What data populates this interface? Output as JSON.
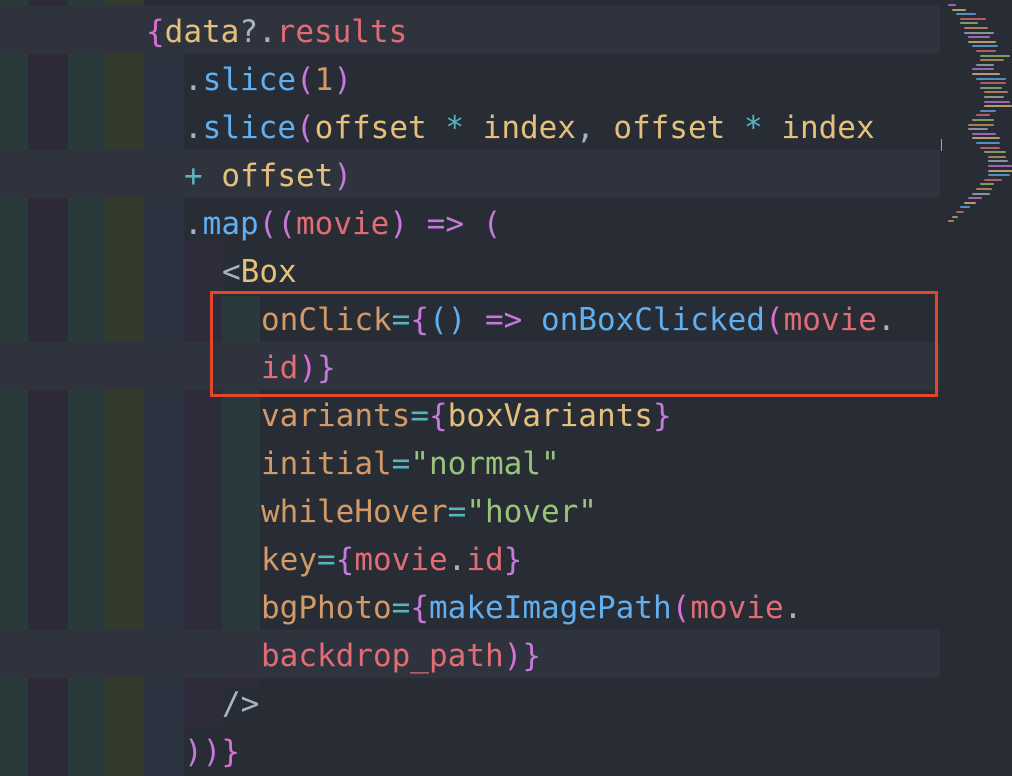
{
  "editor": {
    "colors": {
      "background": "#282c34",
      "highlight_box": "#e2462b",
      "identifier": "#e5c07b",
      "property": "#e06c75",
      "method": "#61afef",
      "string": "#98c379",
      "keyword": "#c678dd",
      "operator": "#56b6c2"
    },
    "lines": [
      [
        {
          "t": "{",
          "c": "c-brace1"
        },
        {
          "t": "data",
          "c": "c-id"
        },
        {
          "t": "?.",
          "c": "c-punct"
        },
        {
          "t": "results",
          "c": "c-prop"
        }
      ],
      [
        {
          "t": ".",
          "c": "c-punct"
        },
        {
          "t": "slice",
          "c": "c-method"
        },
        {
          "t": "(",
          "c": "c-brace2"
        },
        {
          "t": "1",
          "c": "c-num"
        },
        {
          "t": ")",
          "c": "c-brace2"
        }
      ],
      [
        {
          "t": ".",
          "c": "c-punct"
        },
        {
          "t": "slice",
          "c": "c-method"
        },
        {
          "t": "(",
          "c": "c-brace2"
        },
        {
          "t": "offset",
          "c": "c-id"
        },
        {
          "t": " * ",
          "c": "c-op"
        },
        {
          "t": "index",
          "c": "c-id"
        },
        {
          "t": ", ",
          "c": "c-punct"
        },
        {
          "t": "offset",
          "c": "c-id"
        },
        {
          "t": " * ",
          "c": "c-op"
        },
        {
          "t": "index",
          "c": "c-id"
        }
      ],
      [
        {
          "t": "+ ",
          "c": "c-op"
        },
        {
          "t": "offset",
          "c": "c-id"
        },
        {
          "t": ")",
          "c": "c-brace2"
        }
      ],
      [
        {
          "t": ".",
          "c": "c-punct"
        },
        {
          "t": "map",
          "c": "c-method"
        },
        {
          "t": "((",
          "c": "c-brace2"
        },
        {
          "t": "movie",
          "c": "c-var"
        },
        {
          "t": ") ",
          "c": "c-brace2"
        },
        {
          "t": "=>",
          "c": "c-kw"
        },
        {
          "t": " (",
          "c": "c-brace2"
        }
      ],
      [
        {
          "t": "<",
          "c": "c-punct"
        },
        {
          "t": "Box",
          "c": "c-tag"
        }
      ],
      [
        {
          "t": "onClick",
          "c": "c-attr"
        },
        {
          "t": "=",
          "c": "c-op"
        },
        {
          "t": "{",
          "c": "c-brace2"
        },
        {
          "t": "()",
          "c": "c-brace3"
        },
        {
          "t": " => ",
          "c": "c-kw"
        },
        {
          "t": "onBoxClicked",
          "c": "c-fn"
        },
        {
          "t": "(",
          "c": "c-brace1"
        },
        {
          "t": "movie",
          "c": "c-var"
        },
        {
          "t": ".",
          "c": "c-punct"
        }
      ],
      [
        {
          "t": "id",
          "c": "c-var"
        },
        {
          "t": ")",
          "c": "c-brace1"
        },
        {
          "t": "}",
          "c": "c-brace2"
        }
      ],
      [
        {
          "t": "variants",
          "c": "c-attr"
        },
        {
          "t": "=",
          "c": "c-op"
        },
        {
          "t": "{",
          "c": "c-brace2"
        },
        {
          "t": "boxVariants",
          "c": "c-id"
        },
        {
          "t": "}",
          "c": "c-brace2"
        }
      ],
      [
        {
          "t": "initial",
          "c": "c-attr"
        },
        {
          "t": "=",
          "c": "c-op"
        },
        {
          "t": "\"normal\"",
          "c": "c-str"
        }
      ],
      [
        {
          "t": "whileHover",
          "c": "c-attr"
        },
        {
          "t": "=",
          "c": "c-op"
        },
        {
          "t": "\"hover\"",
          "c": "c-str"
        }
      ],
      [
        {
          "t": "key",
          "c": "c-attr"
        },
        {
          "t": "=",
          "c": "c-op"
        },
        {
          "t": "{",
          "c": "c-brace2"
        },
        {
          "t": "movie",
          "c": "c-var"
        },
        {
          "t": ".",
          "c": "c-punct"
        },
        {
          "t": "id",
          "c": "c-var"
        },
        {
          "t": "}",
          "c": "c-brace2"
        }
      ],
      [
        {
          "t": "bgPhoto",
          "c": "c-attr"
        },
        {
          "t": "=",
          "c": "c-op"
        },
        {
          "t": "{",
          "c": "c-brace2"
        },
        {
          "t": "makeImagePath",
          "c": "c-fn"
        },
        {
          "t": "(",
          "c": "c-brace1"
        },
        {
          "t": "movie",
          "c": "c-var"
        },
        {
          "t": ".",
          "c": "c-punct"
        }
      ],
      [
        {
          "t": "backdrop_path",
          "c": "c-var"
        },
        {
          "t": ")",
          "c": "c-brace1"
        },
        {
          "t": "}",
          "c": "c-brace2"
        }
      ],
      [
        {
          "t": "/>",
          "c": "c-punct"
        }
      ],
      [
        {
          "t": "))",
          "c": "c-brace2"
        },
        {
          "t": "}",
          "c": "c-brace1"
        }
      ]
    ]
  }
}
